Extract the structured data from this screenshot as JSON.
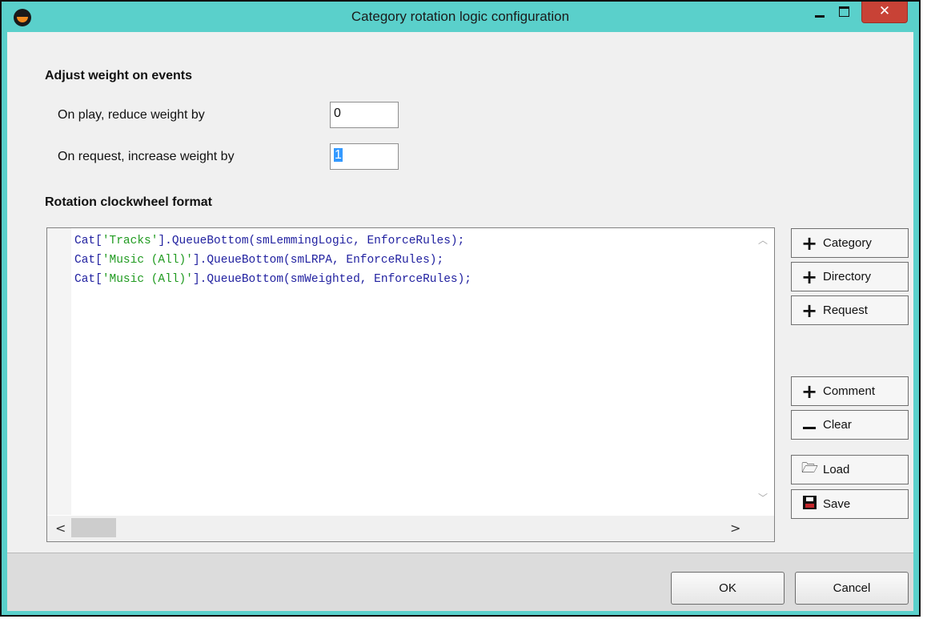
{
  "window": {
    "title": "Category rotation logic configuration",
    "close_glyph": "✕"
  },
  "weights": {
    "section_title": "Adjust weight on events",
    "play_label": "On play, reduce weight by",
    "play_value": "0",
    "request_label": "On request, increase weight by",
    "request_value": "1"
  },
  "clockwheel": {
    "section_title": "Rotation clockwheel format",
    "lines": [
      {
        "prefix": "Cat[",
        "string": "'Tracks'",
        "suffix": "].QueueBottom(smLemmingLogic, EnforceRules);"
      },
      {
        "prefix": "Cat[",
        "string": "'Music (All)'",
        "suffix": "].QueueBottom(smLRPA, EnforceRules);"
      },
      {
        "prefix": "Cat[",
        "string": "'Music (All)'",
        "suffix": "].QueueBottom(smWeighted, EnforceRules);"
      }
    ]
  },
  "scrollbar": {
    "up_glyph": "︿",
    "down_glyph": "﹀",
    "left_glyph": "<",
    "right_glyph": ">"
  },
  "side_buttons": {
    "category": "Category",
    "directory": "Directory",
    "request": "Request",
    "comment": "Comment",
    "clear": "Clear",
    "load": "Load",
    "save": "Save"
  },
  "icons": {
    "plus": "+",
    "folder": "🗁"
  },
  "footer": {
    "ok": "OK",
    "cancel": "Cancel"
  },
  "colors": {
    "titlebar": "#5ad0cb",
    "close_button": "#c84236",
    "code_text": "#2121a0",
    "code_string": "#219b21",
    "selection": "#3399ff"
  }
}
